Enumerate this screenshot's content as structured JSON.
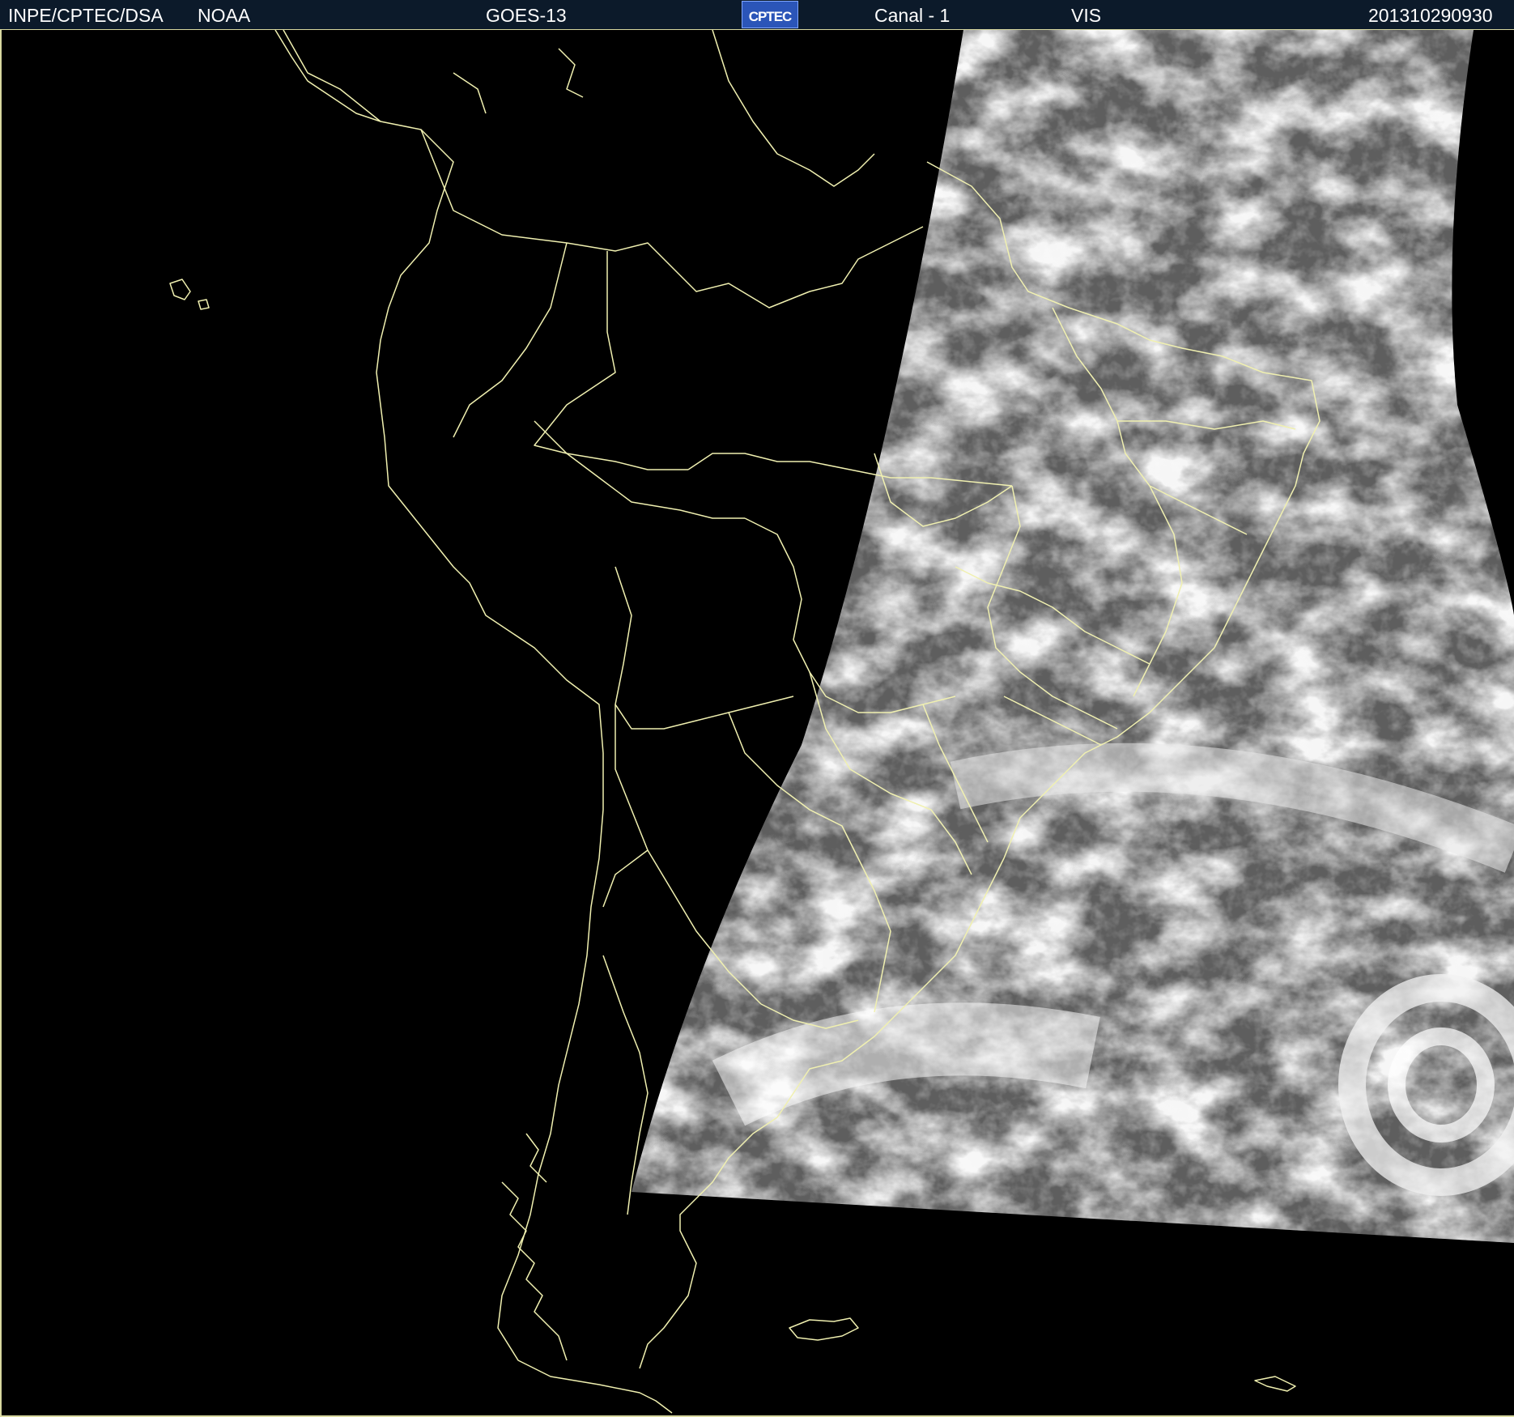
{
  "header": {
    "org": "INPE/CPTEC/DSA",
    "agency": "NOAA",
    "satellite": "GOES-13",
    "logo_text": "CPTEC",
    "channel": "Canal - 1",
    "band": "VIS",
    "timestamp": "201310290930"
  },
  "colors": {
    "header_bg": "#0c1a2a",
    "boundary": "#f0f0b0",
    "background": "#000000",
    "logo_bg": "#2b55b8"
  }
}
